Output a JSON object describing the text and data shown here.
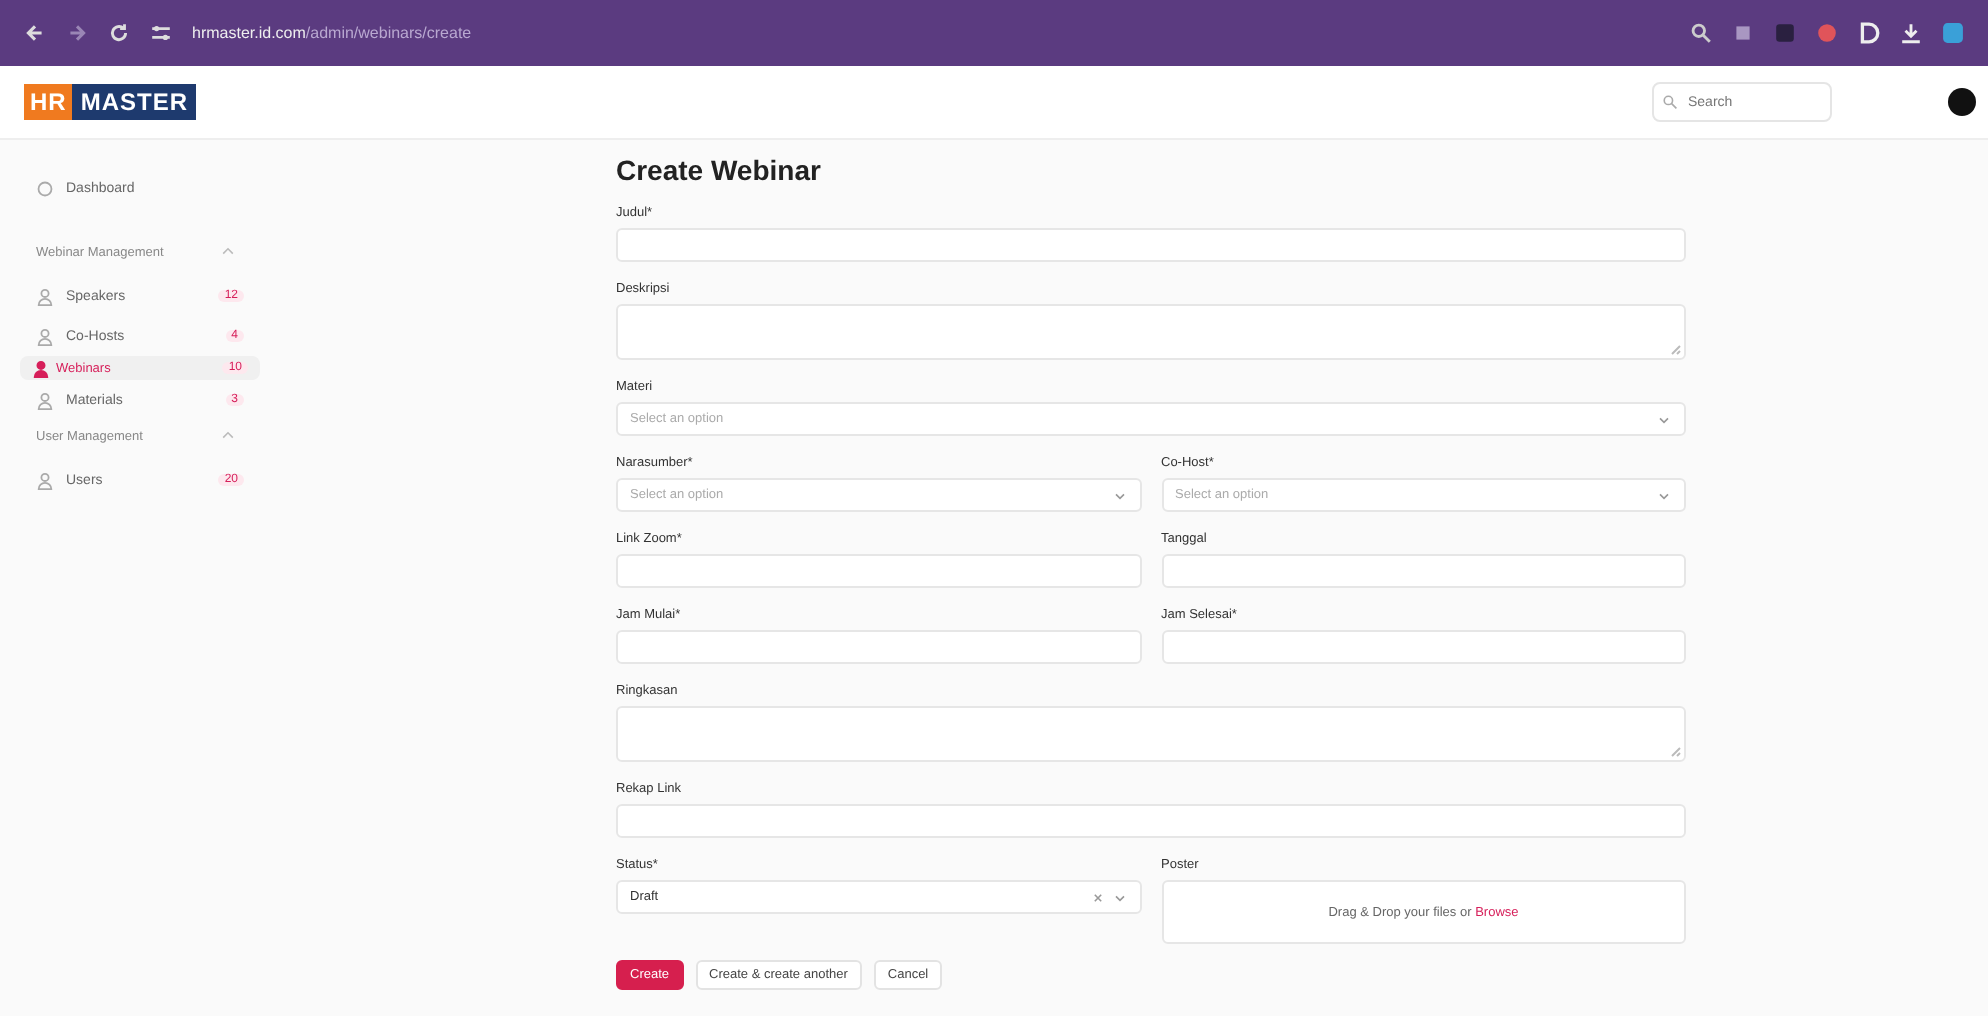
{
  "browser": {
    "url_host": "hrmaster.id.com",
    "url_path": "/admin/webinars/create"
  },
  "header": {
    "logo_left": "HR",
    "logo_right": "MASTER",
    "search": {
      "placeholder": "Search"
    }
  },
  "sidebar": {
    "items": [
      {
        "kind": "link",
        "label": "Dashboard",
        "selected": false
      },
      {
        "kind": "group",
        "label": "Webinar Management",
        "children": [
          {
            "label": "Speakers",
            "badge": "12",
            "selected": false
          },
          {
            "label": "Co-Hosts",
            "badge": "4",
            "selected": false
          },
          {
            "label": "Webinars",
            "badge": "10",
            "selected": true
          },
          {
            "label": "Materials",
            "badge": "3",
            "selected": false
          }
        ]
      },
      {
        "kind": "group",
        "label": "User Management",
        "children": [
          {
            "label": "Users",
            "badge": "20",
            "selected": false
          }
        ]
      }
    ]
  },
  "form": {
    "title": "Create Webinar",
    "rows": [
      [
        {
          "kind": "input",
          "label": "Judul*"
        }
      ],
      [
        {
          "kind": "textarea",
          "label": "Deskripsi"
        }
      ],
      [
        {
          "kind": "select",
          "label": "Materi",
          "placeholder": "Select an option"
        }
      ],
      [
        {
          "kind": "select",
          "label": "Narasumber*",
          "placeholder": "Select an option"
        },
        {
          "kind": "select",
          "label": "Co-Host*",
          "placeholder": "Select an option"
        }
      ],
      [
        {
          "kind": "input",
          "label": "Link Zoom*"
        },
        {
          "kind": "input",
          "label": "Tanggal"
        }
      ],
      [
        {
          "kind": "input",
          "label": "Jam Mulai*"
        },
        {
          "kind": "input",
          "label": "Jam Selesai*"
        }
      ],
      [
        {
          "kind": "textarea",
          "label": "Ringkasan"
        }
      ],
      [
        {
          "kind": "input",
          "label": "Rekap Link"
        }
      ],
      [
        {
          "kind": "select",
          "label": "Status*",
          "value": "Draft",
          "clearable": true
        },
        {
          "kind": "dropzone",
          "label": "Poster",
          "hint": "Drag & Drop your files or",
          "link": "Browse"
        }
      ]
    ],
    "buttons": [
      {
        "kind": "primary",
        "label": "Create"
      },
      {
        "kind": "secondary",
        "label": "Create & create another"
      },
      {
        "kind": "secondary",
        "label": "Cancel"
      }
    ]
  }
}
